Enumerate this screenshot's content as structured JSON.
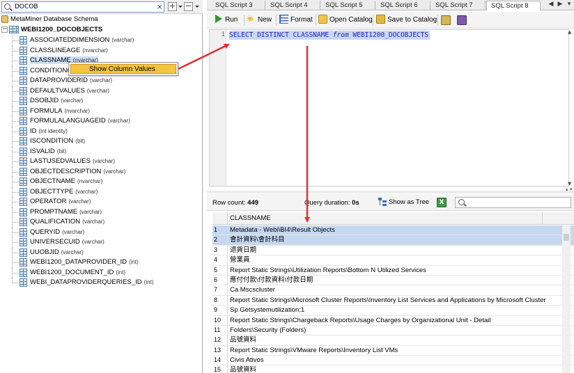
{
  "search": {
    "value": "DOCOB",
    "clear_icon": "×"
  },
  "tree": {
    "root_label": "MetaMiner Database Schema",
    "table_label": "WEBI1200_DOCOBJECTS",
    "columns": [
      {
        "name": "ASSOCIATEDDIMENSION",
        "type": "(varchar)"
      },
      {
        "name": "CLASSLINEAGE",
        "type": "(nvarchar)"
      },
      {
        "name": "CLASSNAME",
        "type": "(nvarchar)"
      },
      {
        "name": "CONDITIONC",
        "type": ""
      },
      {
        "name": "DATAPROVIDERID",
        "type": "(varchar)"
      },
      {
        "name": "DEFAULTVALUES",
        "type": "(varchar)"
      },
      {
        "name": "DSOBJID",
        "type": "(varchar)"
      },
      {
        "name": "FORMULA",
        "type": "(nvarchar)"
      },
      {
        "name": "FORMULALANGUAGEID",
        "type": "(varchar)"
      },
      {
        "name": "ID",
        "type": "(int identity)"
      },
      {
        "name": "ISCONDITION",
        "type": "(bit)"
      },
      {
        "name": "ISVALID",
        "type": "(bit)"
      },
      {
        "name": "LASTUSEDVALUES",
        "type": "(varchar)"
      },
      {
        "name": "OBJECTDESCRIPTION",
        "type": "(varchar)"
      },
      {
        "name": "OBJECTNAME",
        "type": "(nvarchar)"
      },
      {
        "name": "OBJECTTYPE",
        "type": "(varchar)"
      },
      {
        "name": "OPERATOR",
        "type": "(varchar)"
      },
      {
        "name": "PROMPTNAME",
        "type": "(varchar)"
      },
      {
        "name": "QUALIFICATION",
        "type": "(varchar)"
      },
      {
        "name": "QUERYID",
        "type": "(varchar)"
      },
      {
        "name": "UNIVERSECUID",
        "type": "(varchar)"
      },
      {
        "name": "UUOBJID",
        "type": "(varchar)"
      },
      {
        "name": "WEBI1200_DATAPROVIDER_ID",
        "type": "(int)"
      },
      {
        "name": "WEBI1200_DOCUMENT_ID",
        "type": "(int)"
      },
      {
        "name": "WEBI_DATAPROVIDERQUERIES_ID",
        "type": "(int)"
      }
    ],
    "selected_index": 2
  },
  "context_menu": {
    "label": "Show Column Values"
  },
  "tabs": [
    "SQL Script 3",
    "SQL Script 4",
    "SQL Script 5",
    "SQL Script 6",
    "SQL Script 7",
    "SQL Script 8"
  ],
  "active_tab": "SQL Script 8",
  "toolbar": {
    "run": "Run",
    "new": "New",
    "format": "Format",
    "open_catalog": "Open Catalog",
    "save_to_catalog": "Save to Catalog"
  },
  "editor": {
    "line_number": "1",
    "sql": {
      "select": "SELECT",
      "distinct": "DISTINCT",
      "column": "CLASSNAME",
      "from": "from",
      "table": "WEBI1200_DOCOBJECTS"
    }
  },
  "results": {
    "row_count_label": "Row count:",
    "row_count": "449",
    "duration_label": "Query duration:",
    "duration": "0s",
    "show_as_tree": "Show as Tree",
    "column_header": "CLASSNAME",
    "rows": [
      "Metadata - Webi\\BI4\\Result Objects",
      "會計資料\\會計科目",
      "退貨日期",
      "營業員",
      "Report Static Strings\\Utilization Reports\\Bottom N Utilized Services",
      "應付付款\\付款資料\\付款日期",
      "Ca Mscscluster",
      "Report Static Strings\\Microsoft Cluster Reports\\Inventory List Services and Applications by Microsoft Cluster",
      "Sp Getsystemutilization;1",
      "Report Static Strings\\Chargeback Reports\\Usage Charges by Organizational Unit - Detail",
      "Folders\\Security (Folders)",
      "品號資料",
      "Report Static Strings\\VMware Reports\\Inventory List VMs",
      "Civis Ativos",
      "品號資料"
    ],
    "selected_rows": [
      0,
      1
    ]
  },
  "colors": {
    "selection": "#c5d8f0",
    "menu_highlight": "#f4c542",
    "arrow": "#e03030",
    "sql_keyword": "#1f1fbd"
  }
}
